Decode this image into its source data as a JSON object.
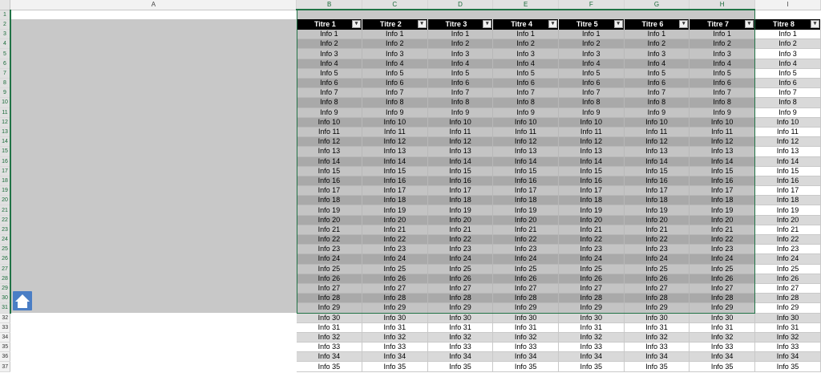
{
  "columns": [
    "A",
    "B",
    "C",
    "D",
    "E",
    "F",
    "G",
    "H",
    "I"
  ],
  "titles": [
    "Titre 1",
    "Titre 2",
    "Titre 3",
    "Titre 4",
    "Titre 5",
    "Titre 6",
    "Titre 7",
    "Titre 8"
  ],
  "filter_icon": "dropdown-arrow",
  "row_numbers": [
    "1",
    "2",
    "3",
    "4",
    "5",
    "6",
    "7",
    "8",
    "9",
    "10",
    "11",
    "12",
    "13",
    "14",
    "15",
    "16",
    "17",
    "18",
    "19",
    "20",
    "21",
    "22",
    "23",
    "24",
    "25",
    "26",
    "27",
    "28",
    "29",
    "30",
    "31",
    "32",
    "33",
    "34",
    "35",
    "36",
    "37"
  ],
  "cells": [
    "Info 1",
    "Info 2",
    "Info 3",
    "Info 4",
    "Info 5",
    "Info 6",
    "Info 7",
    "Info 8",
    "Info 9",
    "Info 10",
    "Info 11",
    "Info 12",
    "Info 13",
    "Info 14",
    "Info 15",
    "Info 16",
    "Info 17",
    "Info 18",
    "Info 19",
    "Info 20",
    "Info 21",
    "Info 22",
    "Info 23",
    "Info 24",
    "Info 25",
    "Info 26",
    "Info 27",
    "Info 28",
    "Info 29",
    "Info 30",
    "Info 31",
    "Info 32",
    "Info 33",
    "Info 34",
    "Info 35"
  ],
  "selection": {
    "range_columns": [
      "B",
      "C",
      "D",
      "E",
      "F",
      "G",
      "H"
    ],
    "range_rows": "1-31"
  },
  "home_button": {
    "icon": "home-icon",
    "color": "#4a7ec5"
  },
  "colors": {
    "accent": "#217346",
    "header_fill": "#000000",
    "band_light": "#c4c4c4",
    "band_dark": "#a9a9a9"
  }
}
